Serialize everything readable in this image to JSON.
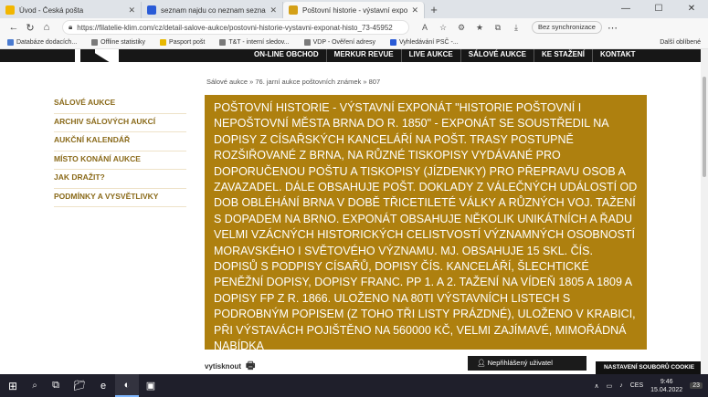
{
  "browser": {
    "tabs": [
      {
        "title": "Úvod - Česká pošta",
        "color": "#f2b600",
        "active": false
      },
      {
        "title": "seznam najdu co neznam seznam",
        "color": "#2a5bd7",
        "active": false
      },
      {
        "title": "Poštovní historie - výstavní expo...",
        "color": "#d4a017",
        "active": true
      }
    ],
    "url": "https://filatelie-klim.com/cz/detail-salove-aukce/postovni-historie-vystavni-exponat-histo_73-45952",
    "sync_label": "Bez synchronizace",
    "bookmarks": [
      {
        "label": "Databáze dodacích...",
        "color": "#4a7bd0"
      },
      {
        "label": "Offline statistiky",
        "color": "#7a7a7a"
      },
      {
        "label": "Pasport pošt",
        "color": "#e8b800"
      },
      {
        "label": "T&T - interní sledov...",
        "color": "#7a7a7a"
      },
      {
        "label": "VDP - Ověření adresy",
        "color": "#7a7a7a"
      },
      {
        "label": "Vyhledávání PSČ -...",
        "color": "#2a5bd7"
      }
    ],
    "bookmarks_more": "Další oblíbené"
  },
  "site": {
    "topnav": [
      "ON-LINE OBCHOD",
      "MERKUR REVUE",
      "LIVE AUKCE",
      "SÁLOVÉ AUKCE",
      "KE STAŽENÍ",
      "KONTAKT"
    ],
    "breadcrumb": "Sálové aukce » 76. jarní aukce poštovních známek » 807",
    "sidebar": [
      "SÁLOVÉ AUKCE",
      "ARCHIV SÁLOVÝCH AUKCÍ",
      "AUKČNÍ KALENDÁŘ",
      "MÍSTO KONÁNÍ AUKCE",
      "JAK DRAŽIT?",
      "PODMÍNKY A VYSVĚTLIVKY"
    ],
    "description": "Poštovní historie - výstavní exponát \"Historie poštovní i nepoštovní města Brna do r. 1850\" - exponát se soustředil na dopisy z císařských kanceláří na pošt. trasy postupně rozšiřované z Brna, na různé tiskopisy vydávané pro doporučenou poštu a tiskopisy (jízdenky) pro přepravu osob a zavazadel. Dále obsahuje pošt. doklady z válečných událostí od dob obléhání Brna v době třicetileté války a různých voj. tažení s dopadem na Brno. Exponát obsahuje několik unikátních a řadu velmi vzácných historických celistvostí významných osobností moravského i světového významu. Mj. obsahuje 15 skl. čís. dopisů s podpisy císařů, dopisy čís. kanceláří, šlechtické peněžní dopisy, dopisy Franc. PP 1. a 2. tažení na Vídeň 1805 a 1809 a dopisy FP z r. 1866. Uloženo na 80ti výstavních listech s podrobným popisem (z toho tři listy prázdné), uloženo v krabici, při výstavách pojištěno na 560000 Kč, velmi zajímavé, mimořádná nabídka",
    "print_label": "vytisknout",
    "login_label": "Nepřihlášený uživatel",
    "cookie_label": "NASTAVENÍ SOUBORŮ COOKIE"
  },
  "taskbar": {
    "lang": "CES",
    "time": "9:46",
    "date": "15.04.2022",
    "notifications": "23"
  }
}
